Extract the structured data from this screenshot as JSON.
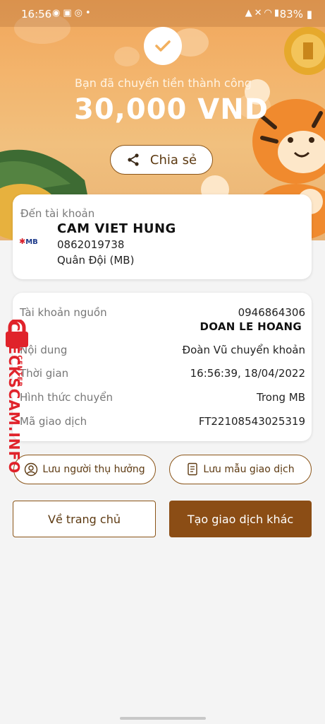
{
  "status_bar": {
    "time": "16:56",
    "battery": "83%",
    "left_icons": [
      "messenger-icon",
      "gallery-icon",
      "incognito-icon"
    ],
    "right_icons": [
      "lock-icon",
      "mute-icon",
      "wifi-icon",
      "signal-icon",
      "battery-icon"
    ]
  },
  "hero": {
    "success_message": "Bạn đã chuyển tiền thành công",
    "amount": "30,000 VND",
    "share_label": "Chia sẻ",
    "colors": {
      "banner": "#f0a55a",
      "accent": "#8b4d15"
    }
  },
  "recipient": {
    "label": "Đến tài khoản",
    "bank_logo_text": "MB",
    "name": "CAM VIET HUNG",
    "account_number": "0862019738",
    "bank": "Quân Đội (MB)"
  },
  "details": {
    "source_label": "Tài khoản nguồn",
    "source_account": "0946864306",
    "source_name": "DOAN LE HOANG",
    "content_label": "Nội dung",
    "content_value": "Đoàn Vũ chuyển khoản",
    "time_label": "Thời gian",
    "time_value": "16:56:39, 18/04/2022",
    "method_label": "Hình thức chuyển",
    "method_value": "Trong MB",
    "tx_label": "Mã giao dịch",
    "tx_value": "FT22108543025319"
  },
  "actions": {
    "save_beneficiary": "Lưu người thụ hưởng",
    "save_template": "Lưu mẫu giao dịch",
    "home": "Về trang chủ",
    "new_transaction": "Tạo giao dịch khác"
  },
  "watermark": {
    "main": "CHECKSCAM.INFO",
    "sub": "DATA CENTER"
  }
}
